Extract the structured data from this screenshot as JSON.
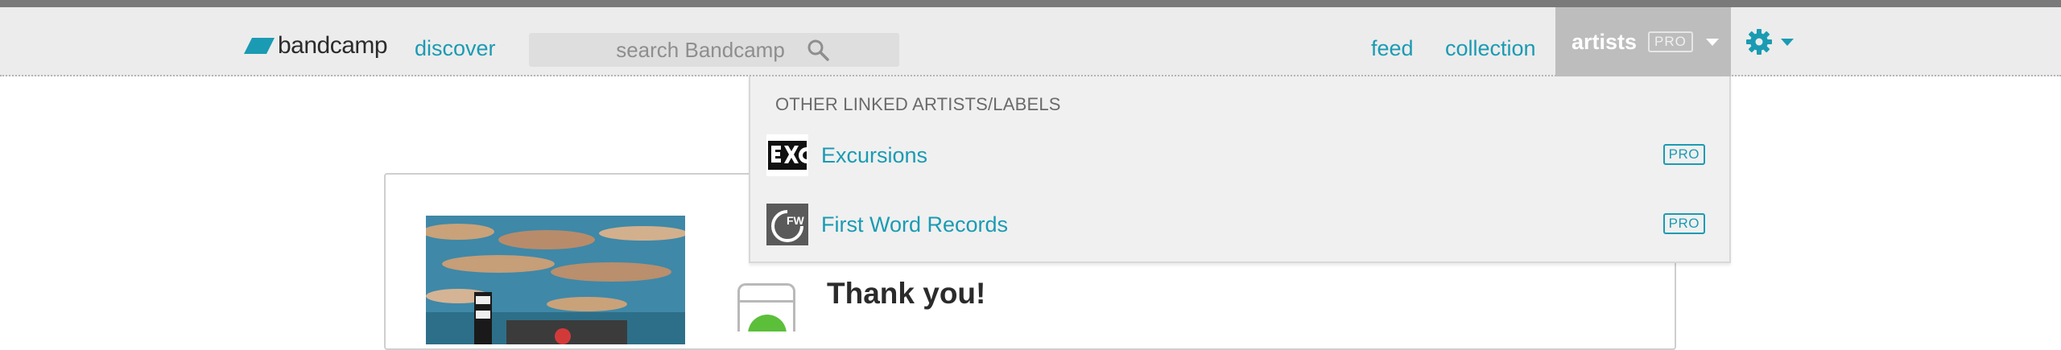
{
  "header": {
    "logo_text": "bandcamp",
    "nav_discover": "discover",
    "search_placeholder": "search Bandcamp",
    "nav_feed": "feed",
    "nav_collection": "collection",
    "artists_label": "artists",
    "artists_badge": "PRO",
    "accent_color": "#1a9bb3"
  },
  "dropdown": {
    "header": "OTHER LINKED ARTISTS/LABELS",
    "items": [
      {
        "label": "Excursions",
        "badge": "PRO",
        "icon": "excursions-logo-icon"
      },
      {
        "label": "First Word Records",
        "badge": "PRO",
        "icon": "first-word-records-logo-icon"
      }
    ]
  },
  "main": {
    "heading": "Thank you!"
  }
}
